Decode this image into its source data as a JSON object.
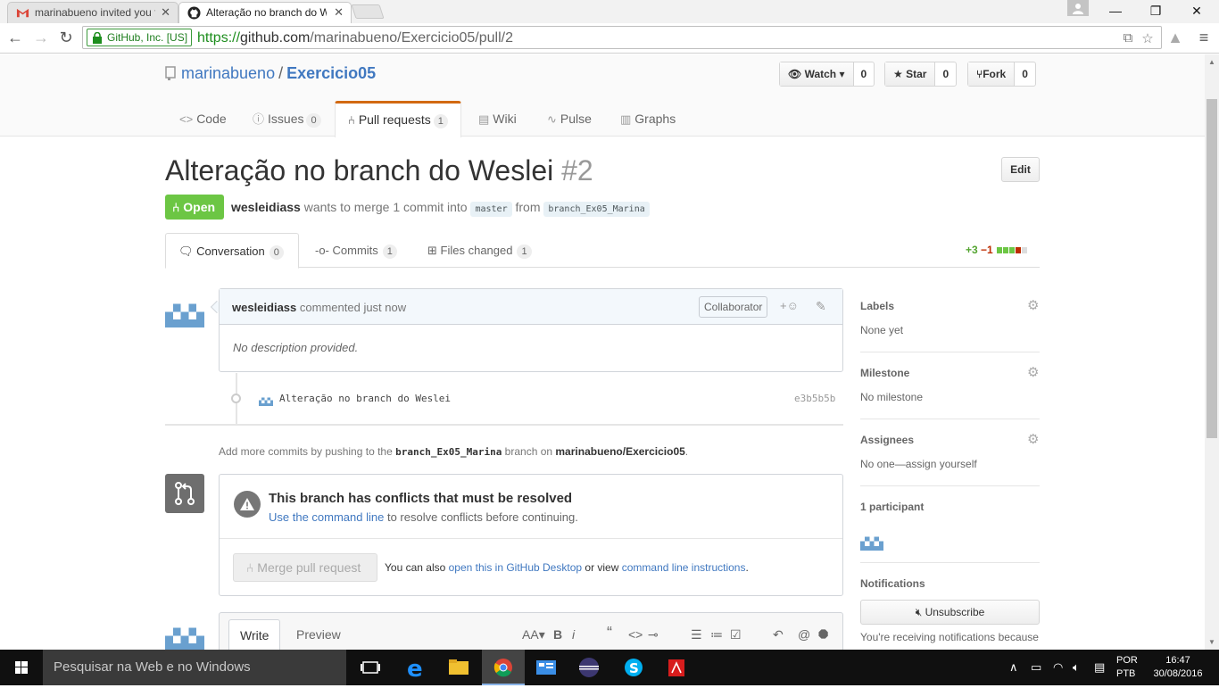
{
  "browser": {
    "tabs": [
      {
        "title": "marinabueno invited you t",
        "icon": "gmail-icon"
      },
      {
        "title": "Alteração no branch do W",
        "icon": "github-icon"
      }
    ],
    "secure_label": "GitHub, Inc. [US]",
    "url_scheme": "https://",
    "url_host": "github.com",
    "url_path": "/marinabueno/Exercicio05/pull/2"
  },
  "repo": {
    "owner": "marinabueno",
    "separator": "/",
    "name": "Exercicio05",
    "watch": {
      "label": "Watch",
      "count": "0"
    },
    "star": {
      "label": "Star",
      "count": "0"
    },
    "fork": {
      "label": "Fork",
      "count": "0"
    },
    "nav": [
      {
        "label": "Code"
      },
      {
        "label": "Issues",
        "count": "0"
      },
      {
        "label": "Pull requests",
        "count": "1"
      },
      {
        "label": "Wiki"
      },
      {
        "label": "Pulse"
      },
      {
        "label": "Graphs"
      }
    ]
  },
  "pr": {
    "title": "Alteração no branch do Weslei",
    "number": "#2",
    "edit_label": "Edit",
    "state": "Open",
    "author": "wesleidiass",
    "meta_mid": "wants to merge 1 commit into",
    "base": "master",
    "from_word": "from",
    "head": "branch_Ex05_Marina",
    "tabs": [
      {
        "label": "Conversation",
        "count": "0"
      },
      {
        "label": "Commits",
        "count": "1"
      },
      {
        "label": "Files changed",
        "count": "1"
      }
    ],
    "additions": "+3",
    "deletions": "−1"
  },
  "comment": {
    "author": "wesleidiass",
    "when": "commented just now",
    "badge": "Collaborator",
    "body": "No description provided."
  },
  "commit": {
    "message": "Alteração no branch do Weslei",
    "sha": "e3b5b5b"
  },
  "push_hint": {
    "prefix": "Add more commits by pushing to the",
    "branch": "branch_Ex05_Marina",
    "mid": "branch on",
    "repo": "marinabueno/Exercicio05",
    "end": "."
  },
  "merge": {
    "title": "This branch has conflicts that must be resolved",
    "link": "Use the command line",
    "sub": "to resolve conflicts before continuing.",
    "button": "Merge pull request",
    "alt_prefix": "You can also",
    "alt_link1": "open this in GitHub Desktop",
    "alt_mid": "or view",
    "alt_link2": "command line instructions",
    "alt_end": "."
  },
  "editor": {
    "write": "Write",
    "preview": "Preview",
    "text_size_label": "AA",
    "bold_label": "B",
    "italic_label": "i"
  },
  "sidebar": {
    "labels_h": "Labels",
    "labels_v": "None yet",
    "milestone_h": "Milestone",
    "milestone_v": "No milestone",
    "assignees_h": "Assignees",
    "assignees_v": "No one—assign yourself",
    "participants_h": "1 participant",
    "notifications_h": "Notifications",
    "unsubscribe": "Unsubscribe",
    "notif_reason": "You're receiving notifications because"
  },
  "taskbar": {
    "search_placeholder": "Pesquisar na Web e no Windows",
    "lang1": "POR",
    "lang2": "PTB",
    "time": "16:47",
    "date": "30/08/2016"
  },
  "colors": {
    "open_green": "#6cc644",
    "link_blue": "#4078c0",
    "tab_accent": "#d26911",
    "diff_add": "#55a532",
    "diff_del": "#bd2c00"
  }
}
